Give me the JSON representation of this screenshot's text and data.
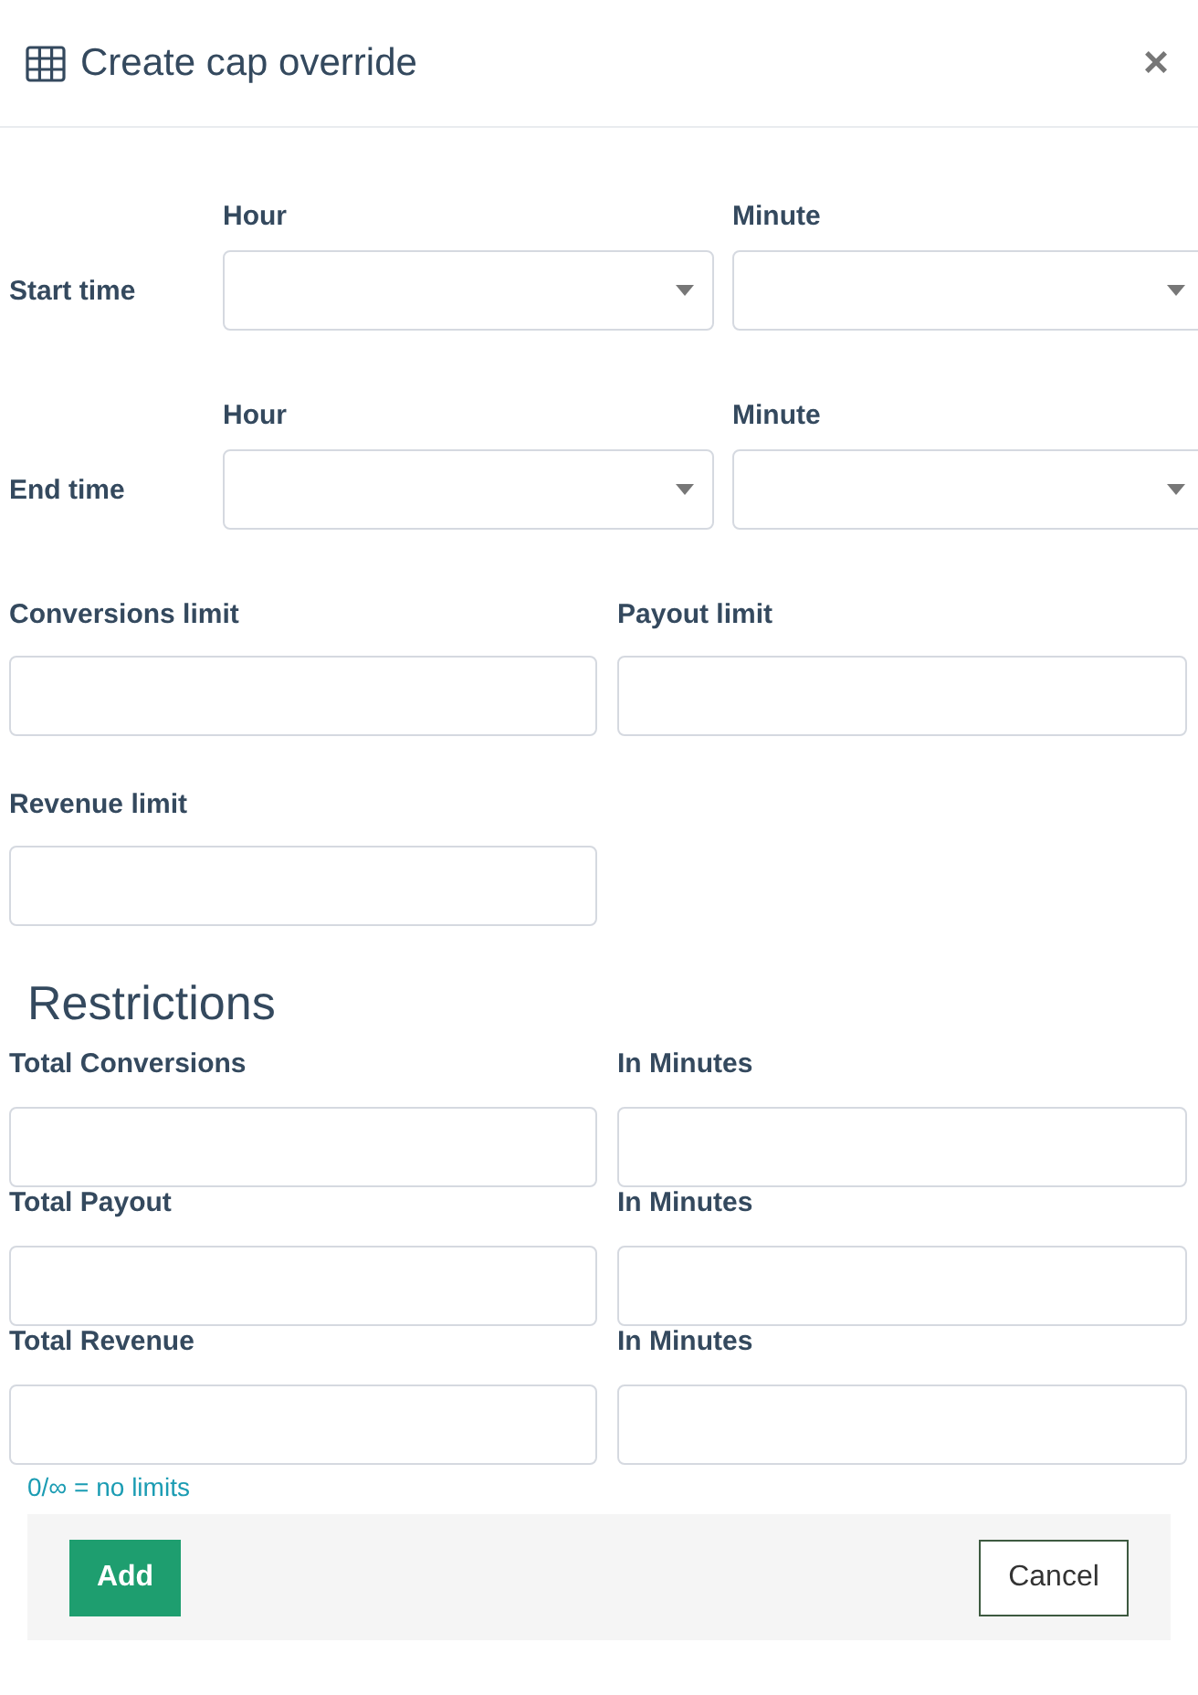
{
  "dialog": {
    "title": "Create cap override",
    "close": "×"
  },
  "time_rows": [
    {
      "label": "Start time",
      "hour_label": "Hour",
      "minute_label": "Minute"
    },
    {
      "label": "End time",
      "hour_label": "Hour",
      "minute_label": "Minute"
    }
  ],
  "limits": [
    {
      "label": "Conversions limit"
    },
    {
      "label": "Payout limit"
    },
    {
      "label": "Revenue limit"
    }
  ],
  "restrictions": {
    "heading": "Restrictions",
    "rows": [
      {
        "label": "Total Conversions",
        "minutes_label": "In Minutes"
      },
      {
        "label": "Total Payout",
        "minutes_label": "In Minutes"
      },
      {
        "label": "Total Revenue",
        "minutes_label": "In Minutes"
      }
    ],
    "hint": "0/∞ = no limits"
  },
  "buttons": [
    {
      "kind": "primary",
      "label": "Add"
    },
    {
      "kind": "secondary",
      "label": "Cancel"
    }
  ]
}
